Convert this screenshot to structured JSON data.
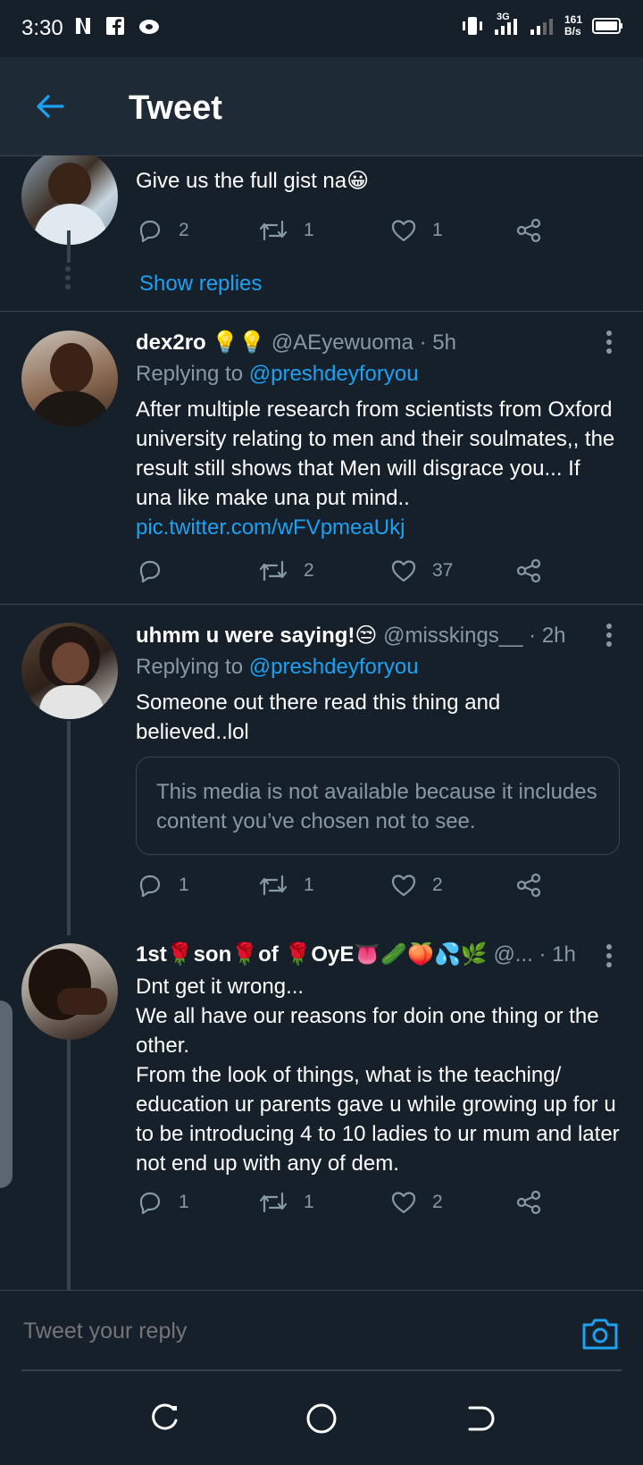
{
  "status_bar": {
    "time": "3:30",
    "network": "3G",
    "speed_value": "161",
    "speed_unit": "B/s"
  },
  "header": {
    "title": "Tweet"
  },
  "tweets": [
    {
      "text": "Give us the full gist na😀",
      "replies": "2",
      "retweets": "1",
      "likes": "1",
      "show_replies": "Show replies"
    },
    {
      "name": "dex2ro 💡💡",
      "handle": "@AEyewuoma · 5h",
      "replying_prefix": "Replying to",
      "replying_to": "@preshdeyforyou",
      "text": "After multiple research from scientists from Oxford university relating to men and their soulmates,, the result still shows that Men will disgrace you... If una like make una put mind..",
      "link": "pic.twitter.com/wFVpmeaUkj",
      "replies": "",
      "retweets": "2",
      "likes": "37"
    },
    {
      "name": "uhmm u were saying!😒",
      "handle": "@misskings__ · 2h",
      "replying_prefix": "Replying to",
      "replying_to": "@preshdeyforyou",
      "text": "Someone out there read this thing and believed..lol",
      "media_notice": "This media is not available because it includes content you’ve chosen not to see.",
      "replies": "1",
      "retweets": "1",
      "likes": "2"
    },
    {
      "name": "1st🌹son🌹of 🌹OyE👅🥒🍑💦🌿",
      "handle": "@... · 1h",
      "text_lines": [
        "Dnt get it wrong...",
        "We all have our reasons for doin one thing or the other.",
        "From the look of things, what is the teaching/ education ur parents gave u while growing up for u to be introducing 4 to 10 ladies to ur mum and later not end up with any of dem."
      ],
      "replies": "1",
      "retweets": "1",
      "likes": "2"
    }
  ],
  "reply_box": {
    "placeholder": "Tweet your reply"
  },
  "colors": {
    "background": "#15202b",
    "header": "#1e2a36",
    "accent": "#1da1f2",
    "secondary_text": "#8899a6",
    "border": "#38444d"
  },
  "icons": [
    "back-arrow-icon",
    "reply-icon",
    "retweet-icon",
    "like-icon",
    "share-icon",
    "more-icon",
    "camera-icon",
    "recents-icon",
    "home-icon",
    "back-nav-icon"
  ]
}
